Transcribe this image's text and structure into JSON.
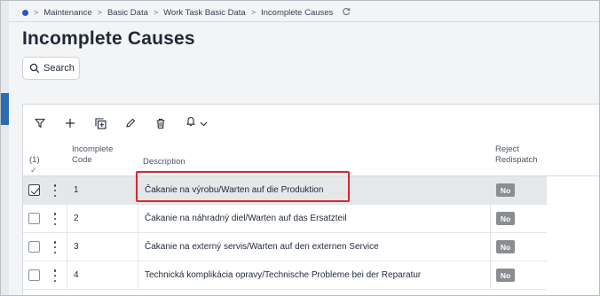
{
  "breadcrumb": {
    "items": [
      "Maintenance",
      "Basic Data",
      "Work Task Basic Data",
      "Incomplete Causes"
    ],
    "separator": ">"
  },
  "page_title": "Incomplete Causes",
  "search": {
    "label": "Search"
  },
  "toolbar": {
    "icons": [
      "filter-icon",
      "add-icon",
      "duplicate-icon",
      "edit-icon",
      "delete-icon",
      "bell-icon",
      "chevron-down-icon"
    ]
  },
  "table": {
    "selection_count": "(1)",
    "selection_mark": "✓",
    "columns": {
      "code_line1": "Incomplete",
      "code_line2": "Code",
      "description": "Description",
      "reject_line1": "Reject",
      "reject_line2": "Redispatch"
    },
    "rows": [
      {
        "code": "1",
        "description": "Čakanie na výrobu/Warten auf die Produktion",
        "reject_redispatch": "No",
        "selected": true
      },
      {
        "code": "2",
        "description": "Čakanie na náhradný diel/Warten auf das Ersatzteil",
        "reject_redispatch": "No",
        "selected": false
      },
      {
        "code": "3",
        "description": "Čakanie na externý servis/Warten auf den externen Service",
        "reject_redispatch": "No",
        "selected": false
      },
      {
        "code": "4",
        "description": "Technická komplikácia opravy/Technische Probleme bei der Reparatur",
        "reject_redispatch": "No",
        "selected": false
      }
    ]
  },
  "colors": {
    "accent": "#2b6cb0",
    "highlight_border": "#d9262c",
    "badge_bg": "#8a8d91",
    "selected_row": "#e6e7e9"
  }
}
